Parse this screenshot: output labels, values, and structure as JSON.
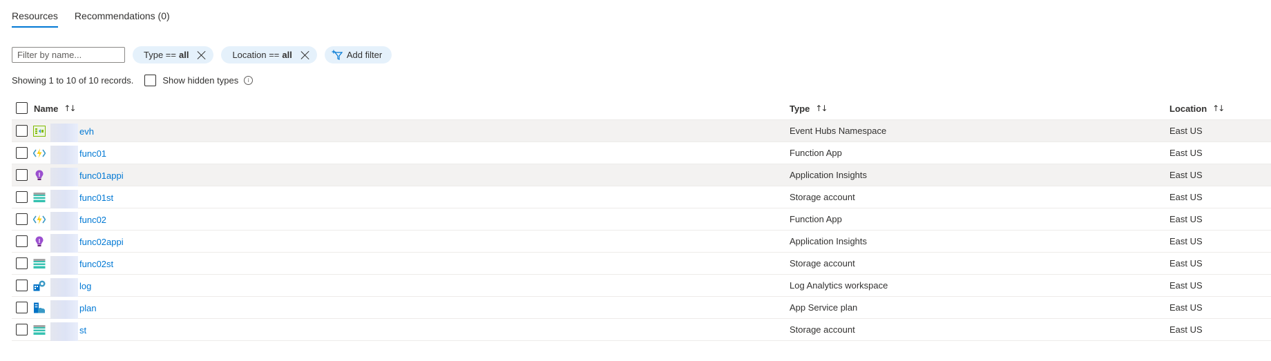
{
  "tabs": [
    {
      "label": "Resources",
      "active": true
    },
    {
      "label": "Recommendations (0)",
      "active": false
    }
  ],
  "filter": {
    "placeholder": "Filter by name...",
    "value": "",
    "pills": [
      {
        "key": "Type ==",
        "value": "all"
      },
      {
        "key": "Location ==",
        "value": "all"
      }
    ],
    "add_filter_label": "Add filter"
  },
  "records": {
    "summary": "Showing 1 to 10 of 10 records.",
    "show_hidden_label": "Show hidden types"
  },
  "table": {
    "columns": [
      {
        "label": "Name",
        "sort": "↑↓"
      },
      {
        "label": "Type",
        "sort": "↑↓"
      },
      {
        "label": "Location",
        "sort": "↑↓"
      }
    ],
    "rows": [
      {
        "name": "evh",
        "type": "Event Hubs Namespace",
        "location": "East US",
        "icon": "event-hubs-icon",
        "shaded": true
      },
      {
        "name": "func01",
        "type": "Function App",
        "location": "East US",
        "icon": "function-app-icon",
        "shaded": false
      },
      {
        "name": "func01appi",
        "type": "Application Insights",
        "location": "East US",
        "icon": "app-insights-icon",
        "shaded": true
      },
      {
        "name": "func01st",
        "type": "Storage account",
        "location": "East US",
        "icon": "storage-account-icon",
        "shaded": false
      },
      {
        "name": "func02",
        "type": "Function App",
        "location": "East US",
        "icon": "function-app-icon",
        "shaded": false
      },
      {
        "name": "func02appi",
        "type": "Application Insights",
        "location": "East US",
        "icon": "app-insights-icon",
        "shaded": false
      },
      {
        "name": "func02st",
        "type": "Storage account",
        "location": "East US",
        "icon": "storage-account-icon",
        "shaded": false
      },
      {
        "name": "log",
        "type": "Log Analytics workspace",
        "location": "East US",
        "icon": "log-analytics-icon",
        "shaded": false
      },
      {
        "name": "plan",
        "type": "App Service plan",
        "location": "East US",
        "icon": "app-service-plan-icon",
        "shaded": false
      },
      {
        "name": "st",
        "type": "Storage account",
        "location": "East US",
        "icon": "storage-account-icon",
        "shaded": false
      }
    ]
  },
  "colors": {
    "accent": "#0078d4",
    "pill_bg": "#e5f1fb",
    "row_shaded": "#f3f2f1",
    "text": "#323130"
  }
}
